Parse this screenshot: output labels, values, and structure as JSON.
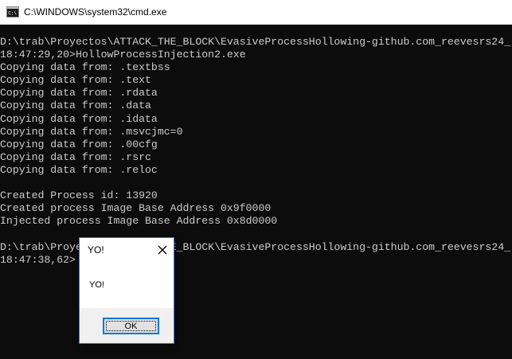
{
  "window": {
    "title": "C:\\WINDOWS\\system32\\cmd.exe",
    "icon": "cmd-console-icon"
  },
  "console": {
    "lines": [
      "D:\\trab\\Proyectos\\ATTACK_THE_BLOCK\\EvasiveProcessHollowing-github.com_reevesrs24_",
      "18:47:29,20>HollowProcessInjection2.exe",
      "Copying data from: .textbss",
      "Copying data from: .text",
      "Copying data from: .rdata",
      "Copying data from: .data",
      "Copying data from: .idata",
      "Copying data from: .msvcjmc=0",
      "Copying data from: .00cfg",
      "Copying data from: .rsrc",
      "Copying data from: .reloc",
      "",
      "Created Process id: 13920",
      "Created process Image Base Address 0x9f0000",
      "Injected process Image Base Address 0x8d0000",
      "",
      "D:\\trab\\Proyectos\\ATTACK_THE_BLOCK\\EvasiveProcessHollowing-github.com_reevesrs24_",
      "18:47:38,62>"
    ]
  },
  "dialog": {
    "title": "YO!",
    "message": "YO!",
    "ok_label": "OK",
    "close_icon": "close-icon"
  },
  "colors": {
    "console_background": "#0c0c0c",
    "console_text": "#cccccc",
    "accent": "#0078d7"
  }
}
